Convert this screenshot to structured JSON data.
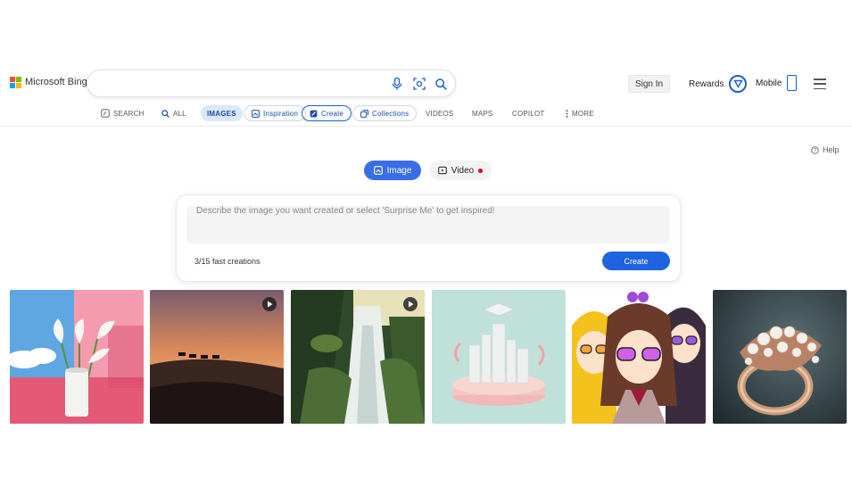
{
  "header": {
    "brand": "Microsoft Bing",
    "search_placeholder": "",
    "signin_label": "Sign In",
    "rewards_label": "Rewards",
    "mobile_label": "Mobile"
  },
  "nav": {
    "items": [
      {
        "label": "SEARCH",
        "icon": "copilot-icon"
      },
      {
        "label": "ALL",
        "icon": "search-icon"
      },
      {
        "label": "IMAGES",
        "active": true
      },
      {
        "label": "Inspiration",
        "icon": "inspiration-icon"
      },
      {
        "label": "Create",
        "icon": "create-icon"
      },
      {
        "label": "Collections",
        "icon": "collections-icon"
      },
      {
        "label": "VIDEOS"
      },
      {
        "label": "MAPS"
      },
      {
        "label": "COPILOT"
      },
      {
        "label": "MORE",
        "icon": "more-vertical-icon"
      }
    ]
  },
  "help_label": "Help",
  "toggle": {
    "image_label": "Image",
    "video_label": "Video"
  },
  "create_card": {
    "prompt_placeholder": "Describe the image you want created or select 'Surprise Me' to get inspired!",
    "creations_text": "3/15 fast creations",
    "create_button": "Create"
  },
  "gallery": [
    {
      "subject": "calla lilies in white vase",
      "video": false
    },
    {
      "subject": "camel caravan on desert dune at sunset",
      "video": true
    },
    {
      "subject": "forest waterfall",
      "video": true
    },
    {
      "subject": "pastel graduation city diorama",
      "video": false
    },
    {
      "subject": "three anime characters with sunglasses",
      "video": false
    },
    {
      "subject": "rose gold pearl ring",
      "video": false
    }
  ],
  "colors": {
    "accent": "#1e63e0",
    "toggle_active": "#3a6ee8",
    "notify_red": "#d9001b"
  }
}
